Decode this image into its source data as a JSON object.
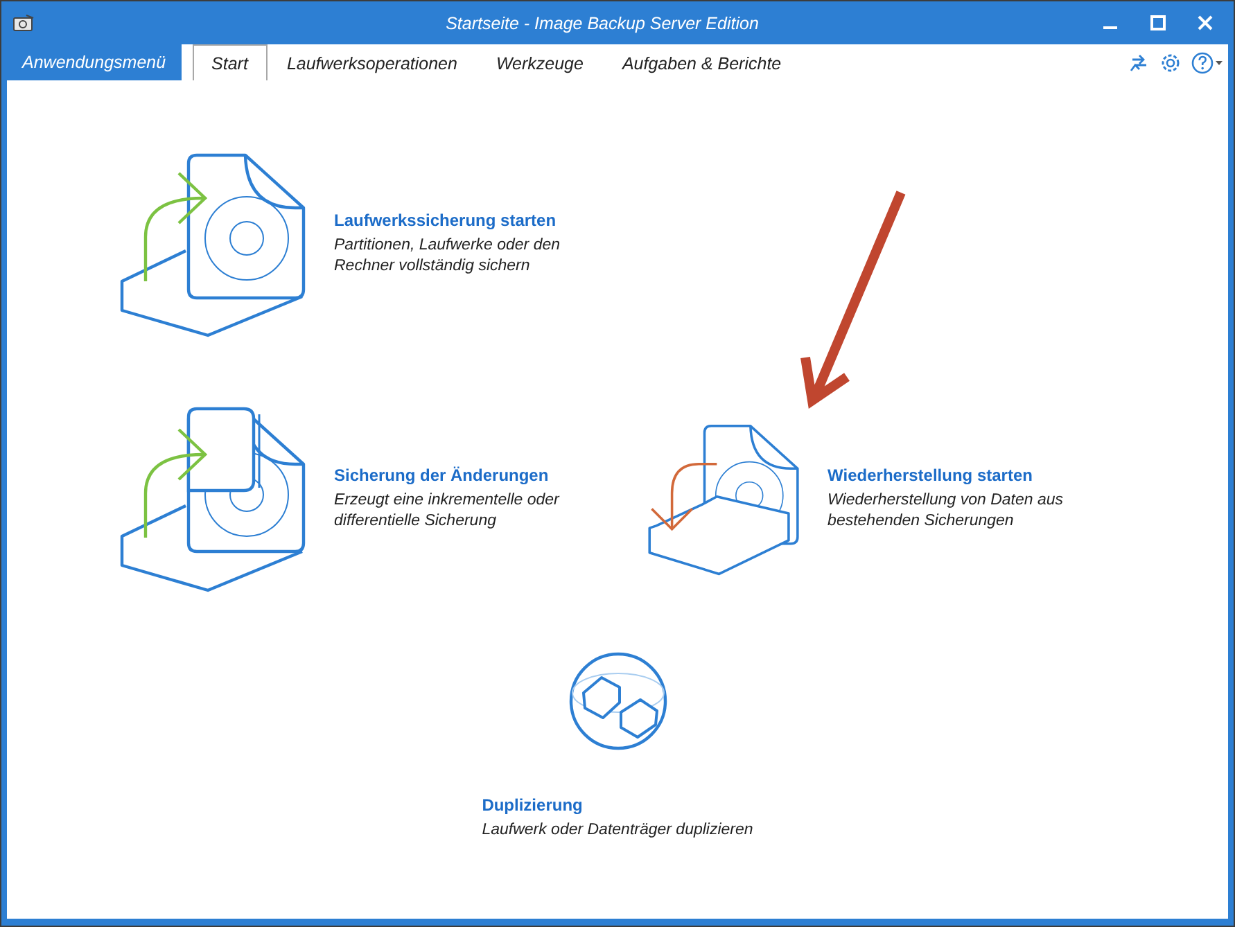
{
  "window": {
    "title": "Startseite - Image Backup Server Edition"
  },
  "tabs": [
    {
      "label": "Anwendungsmenü",
      "kind": "app_menu"
    },
    {
      "label": "Start",
      "kind": "tab",
      "selected": true
    },
    {
      "label": "Laufwerksoperationen",
      "kind": "tab",
      "selected": false
    },
    {
      "label": "Werkzeuge",
      "kind": "tab",
      "selected": false
    },
    {
      "label": "Aufgaben & Berichte",
      "kind": "tab",
      "selected": false
    }
  ],
  "actions": [
    {
      "kind": "full_backup",
      "title": "Laufwerkssicherung starten",
      "description": [
        "Partitionen, Laufwerke oder den",
        "Rechner vollständig sichern"
      ]
    },
    {
      "kind": "incremental",
      "title": "Sicherung der Änderungen",
      "description": [
        "Erzeugt eine inkrementelle oder",
        "differentielle Sicherung"
      ]
    },
    {
      "kind": "restore",
      "title": "Wiederherstellung starten",
      "description": [
        "Wiederherstellung von Daten aus",
        "bestehenden Sicherungen"
      ]
    }
  ],
  "duplicate_action": {
    "kind": "duplicate",
    "title": "Duplizierung",
    "description": [
      "Laufwerk oder Datenträger duplizieren"
    ]
  }
}
